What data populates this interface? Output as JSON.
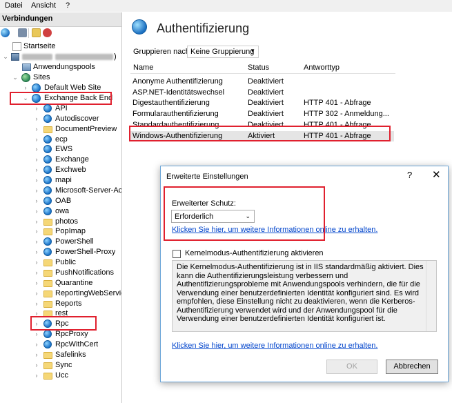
{
  "menubar": {
    "items": [
      "Datei",
      "Ansicht",
      "?"
    ]
  },
  "connections": {
    "title": "Verbindungen",
    "tree": {
      "start": "Startseite",
      "server_suffix": ")",
      "app_pools": "Anwendungspools",
      "sites": "Sites",
      "default_site": "Default Web Site",
      "backend": "Exchange Back End",
      "children": [
        "API",
        "Autodiscover",
        "DocumentPreview",
        "ecp",
        "EWS",
        "Exchange",
        "Exchweb",
        "mapi",
        "Microsoft-Server-Act",
        "OAB",
        "owa",
        "photos",
        "PopImap",
        "PowerShell",
        "PowerShell-Proxy",
        "Public",
        "PushNotifications",
        "Quarantine",
        "ReportingWebService",
        "Reports",
        "rest",
        "Rpc",
        "RpcProxy",
        "RpcWithCert",
        "Safelinks",
        "Sync",
        "Ucc"
      ]
    }
  },
  "main": {
    "title": "Authentifizierung",
    "group_label": "Gruppieren nach:",
    "group_value": "Keine Gruppierung",
    "columns": [
      "Name",
      "Status",
      "Antworttyp"
    ],
    "rows": [
      {
        "name": "Anonyme Authentifizierung",
        "status": "Deaktiviert",
        "response": ""
      },
      {
        "name": "ASP.NET-Identitätswechsel",
        "status": "Deaktiviert",
        "response": ""
      },
      {
        "name": "Digestauthentifizierung",
        "status": "Deaktiviert",
        "response": "HTTP 401 - Abfrage"
      },
      {
        "name": "Formularauthentifizierung",
        "status": "Deaktiviert",
        "response": "HTTP 302 - Anmeldung..."
      },
      {
        "name": "Standardauthentifizierung",
        "status": "Deaktiviert",
        "response": "HTTP 401 - Abfrage"
      },
      {
        "name": "Windows-Authentifizierung",
        "status": "Aktiviert",
        "response": "HTTP 401 - Abfrage"
      }
    ]
  },
  "dialog": {
    "title": "Erweiterte Einstellungen",
    "help_glyph": "?",
    "close_glyph": "✕",
    "extended_protection_label": "Erweiterter Schutz:",
    "extended_protection_value": "Erforderlich",
    "more_info_link": "Klicken Sie hier, um weitere Informationen online zu erhalten.",
    "kernel_mode_label": "Kernelmodus-Authentifizierung aktivieren",
    "kernel_mode_checked": false,
    "description": "Die Kernelmodus-Authentifizierung ist in IIS standardmäßig aktiviert. Dies kann die Authentifizierungsleistung verbessern und Authentifizierungsprobleme mit Anwendungspools verhindern, die für die Verwendung einer benutzerdefinierten Identität konfiguriert sind. Es wird empfohlen, diese Einstellung nicht zu deaktivieren, wenn die Kerberos-Authentifizierung verwendet wird und der Anwendungspool für die Verwendung einer benutzerdefinierten Identität konfiguriert ist.",
    "more_info_link2": "Klicken Sie hier, um weitere Informationen online zu erhalten.",
    "ok_label": "OK",
    "cancel_label": "Abbrechen"
  },
  "colors": {
    "highlight": "#e0202e",
    "link": "#0044cc",
    "selected_row": "#e5e5e5"
  }
}
